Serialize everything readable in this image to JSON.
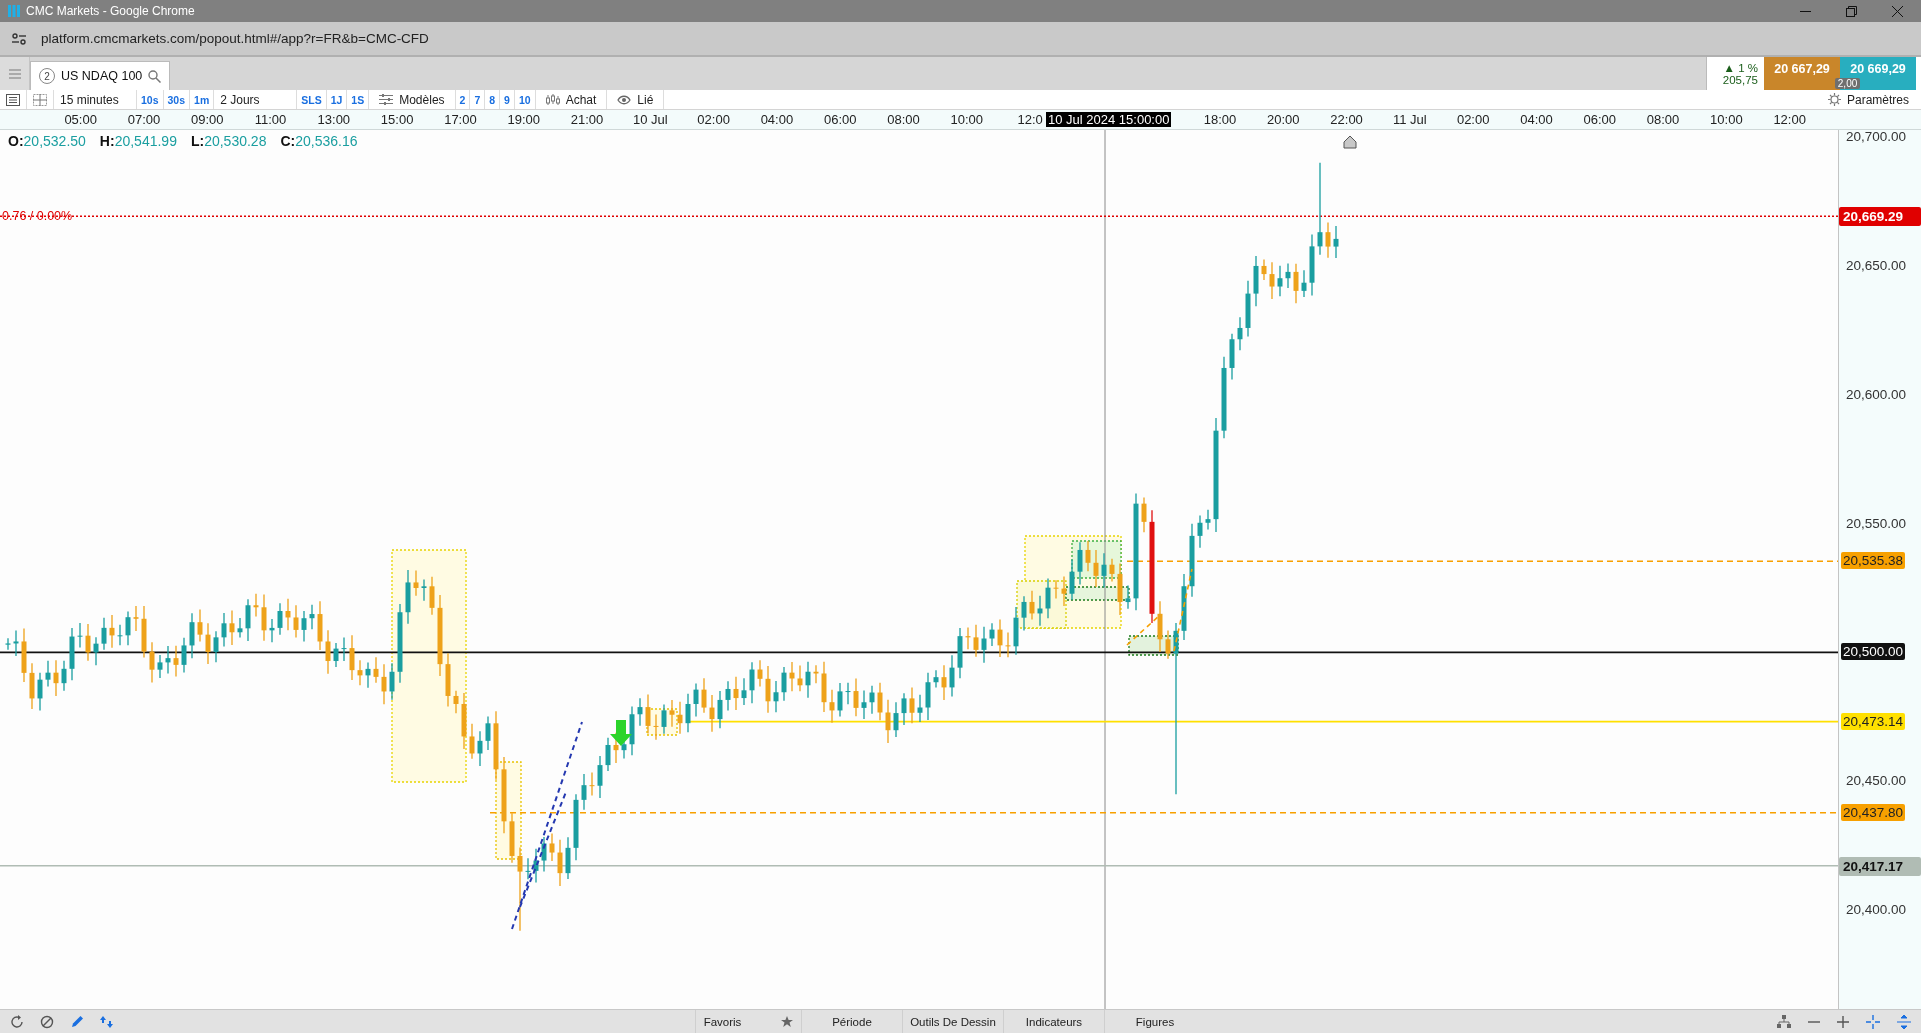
{
  "window": {
    "title": "CMC Markets - Google Chrome"
  },
  "address_bar": {
    "url": "platform.cmcmarkets.com/popout.html#/app?r=FR&b=CMC-CFD"
  },
  "instrument_tab": {
    "badge": "2",
    "label": "US NDAQ 100",
    "selected": true
  },
  "quote": {
    "change": "▲ 1 %",
    "change_points": "205,75",
    "sell": "20 667,29",
    "buy": "20 669,29",
    "spread": "2,00"
  },
  "toolbar": {
    "interval": "15 minutes",
    "interval_shortcuts": [
      "10s",
      "30s",
      "1m"
    ],
    "range": "2 Jours",
    "range_shortcuts": [
      "SLS",
      "1J",
      "1S"
    ],
    "templates": "Modèles",
    "template_slots": [
      "2",
      "7",
      "8",
      "9",
      "10"
    ],
    "order": "Achat",
    "link": "Lié",
    "settings": "Paramètres"
  },
  "time_axis": {
    "labels": [
      "05:00",
      "07:00",
      "09:00",
      "11:00",
      "13:00",
      "15:00",
      "17:00",
      "19:00",
      "21:00",
      "10 Jul",
      "02:00",
      "04:00",
      "06:00",
      "08:00",
      "10:00",
      "12:0",
      "18:00",
      "20:00",
      "22:00",
      "11 Jul",
      "02:00",
      "04:00",
      "06:00",
      "08:00",
      "10:00",
      "12:00"
    ],
    "crosshair": "10 Jul 2024 15:00:00"
  },
  "ohlc": [
    {
      "key": "O:",
      "value": "20,532.50"
    },
    {
      "key": "H:",
      "value": "20,541.99"
    },
    {
      "key": "L:",
      "value": "20,530.28"
    },
    {
      "key": "C:",
      "value": "20,536.16"
    }
  ],
  "price_axis": {
    "ticks": [
      "20,700.00",
      "20,650.00",
      "20,600.00",
      "20,550.00",
      "20,450.00",
      "20,400.00"
    ]
  },
  "levels": [
    {
      "kind": "dotted",
      "color": "#e00000",
      "label": "20,669.29",
      "annotation": "0.76 / 0.00%"
    },
    {
      "kind": "dashed",
      "color": "#f7a000",
      "label": "20,535.38"
    },
    {
      "kind": "solid",
      "color": "#111111",
      "label": "20,500.00"
    },
    {
      "kind": "solid",
      "color": "#ffe000",
      "label": "20,473.14"
    },
    {
      "kind": "dashed",
      "color": "#f7a000",
      "label": "20,437.80"
    },
    {
      "kind": "crosshair",
      "color": "#b0bcb4",
      "label": "20,417.17"
    }
  ],
  "bottom_bar": {
    "tabs": [
      "Favoris",
      "Période",
      "Outils De Dessin",
      "Indicateurs",
      "Figures"
    ]
  }
}
